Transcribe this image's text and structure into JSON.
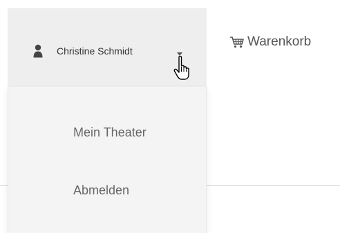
{
  "header": {
    "user": {
      "icon": "user-icon",
      "name": "Christine Schmidt",
      "caret_icon": "caret-down-icon",
      "background": "#eeeeee"
    },
    "cart": {
      "icon": "shopping-cart-icon",
      "label": "Warenkorb"
    }
  },
  "dropdown": {
    "items": [
      {
        "label": "Mein Theater"
      },
      {
        "label": "Abmelden"
      }
    ],
    "background": "#f4f4f4"
  },
  "cursor": {
    "icon": "hand-pointer-cursor-icon"
  }
}
